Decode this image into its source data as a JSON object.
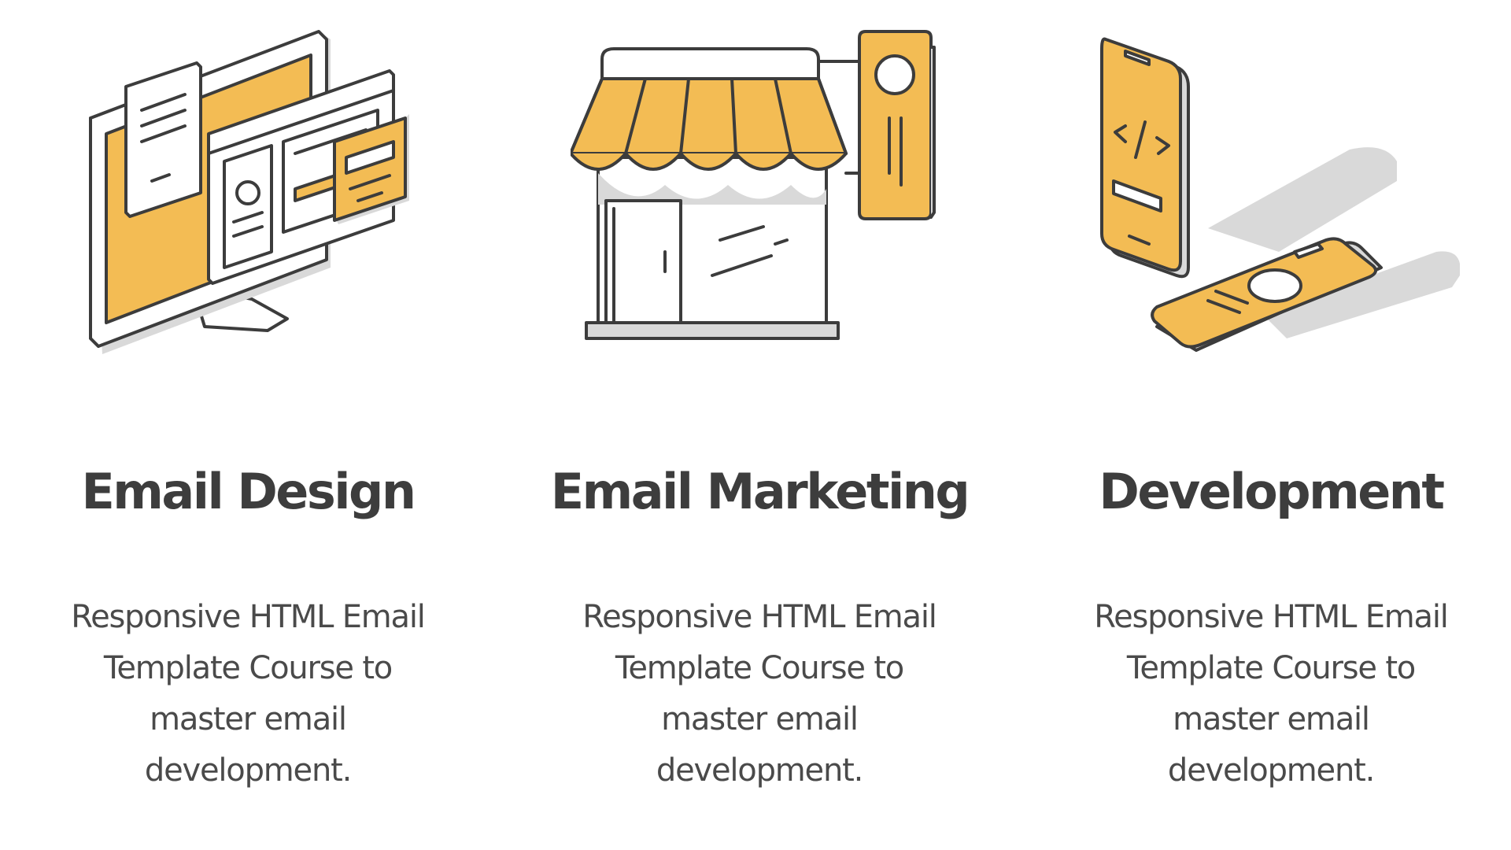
{
  "colors": {
    "accent": "#F3BC54",
    "outline": "#3C3C3C",
    "shadow": "#D9D9D9",
    "text": "#3F3F3F"
  },
  "features": [
    {
      "icon": "devices-icon",
      "title": "Email Design",
      "description": "Responsive HTML Email Template Course to master email development."
    },
    {
      "icon": "storefront-icon",
      "title": "Email Marketing",
      "description": "Responsive HTML Email Template Course to master email development."
    },
    {
      "icon": "mobile-code-icon",
      "title": "Development",
      "description": "Responsive HTML Email Template Course to master email development."
    }
  ]
}
